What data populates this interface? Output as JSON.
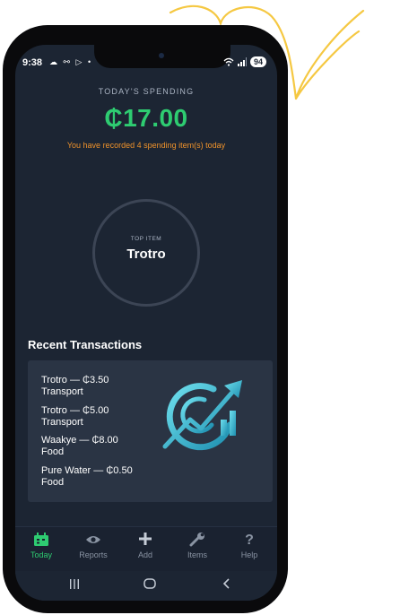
{
  "status_bar": {
    "time": "9:38",
    "left_icons": "☁ ⚯ ▷ •",
    "battery": "94"
  },
  "spending": {
    "label": "TODAY'S SPENDING",
    "amount": "₵17.00",
    "subtitle": "You have recorded 4 spending item(s) today"
  },
  "top_item": {
    "label": "TOP ITEM",
    "value": "Trotro"
  },
  "recent": {
    "title": "Recent Transactions",
    "items": [
      {
        "line1": "Trotro — ₵3.50",
        "line2": "Transport"
      },
      {
        "line1": "Trotro — ₵5.00",
        "line2": "Transport"
      },
      {
        "line1": "Waakye — ₵8.00",
        "line2": "Food"
      },
      {
        "line1": "Pure Water — ₵0.50",
        "line2": "Food"
      }
    ]
  },
  "nav": {
    "items": [
      {
        "label": "Today",
        "icon": "calendar-icon",
        "active": true
      },
      {
        "label": "Reports",
        "icon": "eye-icon",
        "active": false
      },
      {
        "label": "Add",
        "icon": "plus-icon",
        "active": false
      },
      {
        "label": "Items",
        "icon": "wrench-icon",
        "active": false
      },
      {
        "label": "Help",
        "icon": "question-icon",
        "active": false
      }
    ]
  },
  "colors": {
    "accent_green": "#2ecc71",
    "accent_orange": "#f0932b",
    "background": "#1c2533",
    "decoration_yellow": "#f5c842"
  }
}
